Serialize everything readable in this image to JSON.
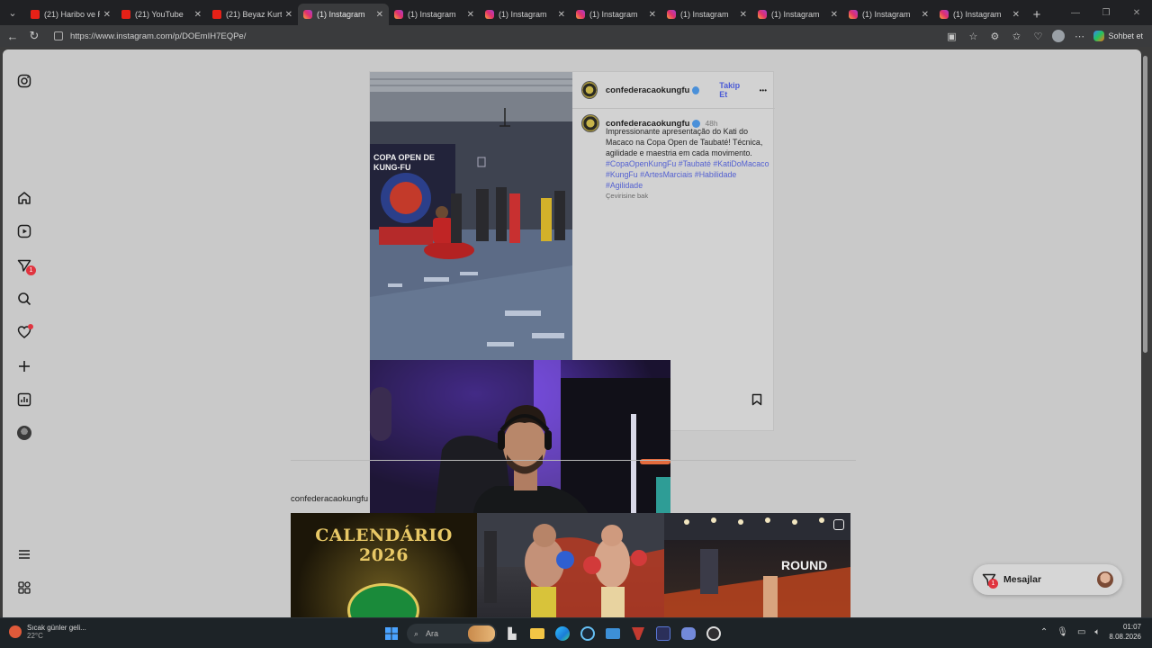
{
  "browser": {
    "tabs": [
      {
        "title": "(21) Haribo ve Re",
        "icon": "youtube",
        "active": false
      },
      {
        "title": "(21) YouTube",
        "icon": "youtube",
        "active": false
      },
      {
        "title": "(21) Beyaz Kurt -",
        "icon": "youtube",
        "active": false
      },
      {
        "title": "(1) Instagram",
        "icon": "instagram",
        "active": true
      },
      {
        "title": "(1) Instagram",
        "icon": "instagram",
        "active": false
      },
      {
        "title": "(1) Instagram",
        "icon": "instagram",
        "active": false
      },
      {
        "title": "(1) Instagram",
        "icon": "instagram",
        "active": false
      },
      {
        "title": "(1) Instagram",
        "icon": "instagram",
        "active": false
      },
      {
        "title": "(1) Instagram",
        "icon": "instagram",
        "active": false
      },
      {
        "title": "(1) Instagram",
        "icon": "instagram",
        "active": false
      },
      {
        "title": "(1) Instagram",
        "icon": "instagram",
        "active": false
      }
    ],
    "url": "https://www.instagram.com/p/DOEmIH7EQPe/",
    "copilot_label": "Sohbet et"
  },
  "sidebar": {
    "items": [
      {
        "name": "instagram-logo-icon"
      },
      {
        "name": "home-icon"
      },
      {
        "name": "reels-icon"
      },
      {
        "name": "messages-icon",
        "badge": "1"
      },
      {
        "name": "search-icon"
      },
      {
        "name": "notifications-icon",
        "dot": true
      },
      {
        "name": "create-icon"
      },
      {
        "name": "dashboard-icon"
      },
      {
        "name": "profile-avatar"
      },
      {
        "name": "menu-icon"
      },
      {
        "name": "also-from-meta-icon"
      }
    ]
  },
  "post": {
    "username": "confederacaokungfu",
    "follow_label": "Takip Et",
    "more_label": "•••",
    "time": "48h",
    "caption_text": "Impressionante apresentação do Kati do Macaco na Copa Open de Taubaté! Técnica, agilidade e maestria em cada movimento.",
    "hashtags": [
      "#CopaOpenKungFu",
      "#Taubaté",
      "#KatiDoMacaco",
      "#KungFu",
      "#ArtesMarciais",
      "#Habilidade",
      "#Agilidade"
    ],
    "see_translation": "Çevirisine bak",
    "photo_banner": "COPA OPEN DE KUNG-FU"
  },
  "more_from": {
    "label": "confederacaokungfu",
    "thumbs": [
      {
        "text": "CALENDÁRIO 2026"
      },
      {
        "text": ""
      },
      {
        "text": "ROUND"
      }
    ]
  },
  "messages": {
    "label": "Mesajlar",
    "badge": "1"
  },
  "taskbar": {
    "weather_line1": "Sıcak günler geli...",
    "weather_line2": "22°C",
    "search_placeholder": "Ara",
    "time": "01:07",
    "date": "8.08.2026"
  },
  "colors": {
    "accent_link": "#4b5bd6",
    "badge_red": "#e0343f"
  }
}
